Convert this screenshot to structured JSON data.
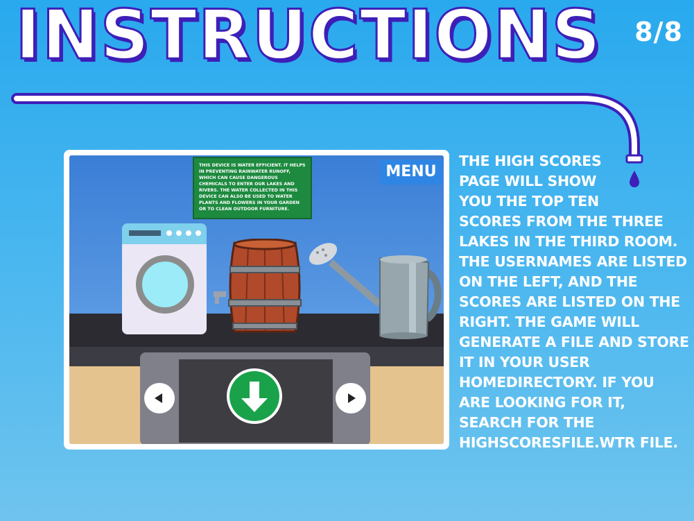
{
  "header": {
    "title": "INSTRUCTIONS",
    "page_counter": "8/8"
  },
  "preview": {
    "info_text": "This device is water efficient. It helps in preventing rainwater runoff, which can cause dangerous chemicals to enter our lakes and rivers. The water collected in this device can also be used to water plants and flowers in your garden or to clean outdoor furniture.",
    "menu_label": "MENU",
    "objects": [
      "washing-machine",
      "rain-barrel",
      "watering-can"
    ],
    "controls": {
      "left_icon": "arrow-left-icon",
      "right_icon": "arrow-right-icon",
      "down_icon": "arrow-down-icon"
    }
  },
  "description": "The high scores\npage will show\nyou the top ten\nscores from the three\nlakes in the third room.\nThe usernames are listed\non the left, and the\nscores are listed on the\nright. The game will\ngenerate a file and store\nit in your user\nhomedirectory. If you\nare looking for it,\nsearch for the\nhighscoresfile.wtr file.",
  "colors": {
    "background": "#29a9ee",
    "title_outline": "#3d1fb8",
    "info_box": "#1d8a3f",
    "menu_button": "#2f85e3",
    "down_button": "#1aa24a"
  }
}
